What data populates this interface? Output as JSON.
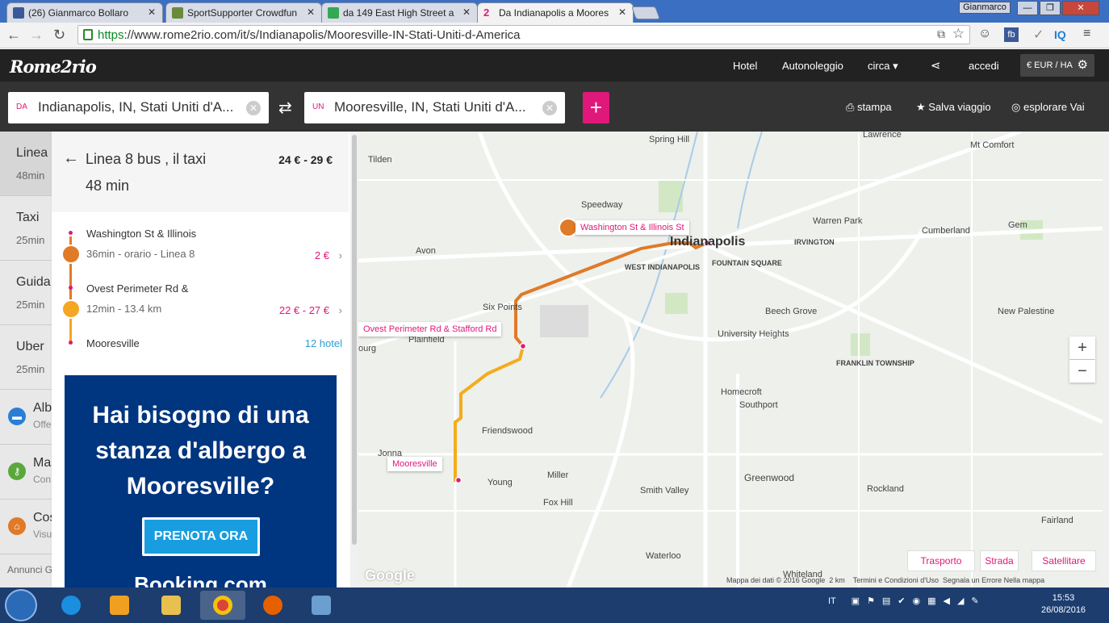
{
  "browser": {
    "tabs": [
      {
        "title": "(26) Gianmarco Bollaro",
        "icon": "facebook-icon",
        "color": "#3b5998"
      },
      {
        "title": "SportSupporter Crowdfun",
        "icon": "sportsupporter-icon",
        "color": "#6a8a3a"
      },
      {
        "title": "da 149 East High Street a",
        "icon": "google-maps-icon",
        "color": "#34a853"
      },
      {
        "title": "Da Indianapolis a Moores",
        "icon": "rome2rio-icon",
        "color": "#e0187a"
      }
    ],
    "user": "Gianmarco",
    "url_scheme": "https",
    "url_rest": "://www.rome2rio.com/it/s/Indianapolis/Mooresville-IN-Stati-Uniti-d-America"
  },
  "header": {
    "logo": "Rome2rio",
    "nav": [
      "Hotel",
      "Autonoleggio",
      "circa"
    ],
    "login": "accedi",
    "currency": "€ EUR / HA"
  },
  "search": {
    "from_label": "DA",
    "from_value": "Indianapolis, IN, Stati Uniti d'A...",
    "to_label": "UN",
    "to_value": "Mooresville, IN, Stati Uniti d'A...",
    "actions": {
      "print": "stampa",
      "save": "Salva viaggio",
      "explore": "esplorare Vai"
    }
  },
  "options": [
    {
      "name": "Linea",
      "time": "48min"
    },
    {
      "name": "Taxi",
      "time": "25min"
    },
    {
      "name": "Guida",
      "time": "25min"
    },
    {
      "name": "Uber",
      "time": "25min"
    }
  ],
  "services": [
    {
      "name": "Alb",
      "sub": "Offe",
      "icon": "bed-icon",
      "color": "#2a7fd4"
    },
    {
      "name": "Ma",
      "sub": "Con",
      "icon": "key-icon",
      "color": "#5aa83c"
    },
    {
      "name": "Cos",
      "sub": "Visu",
      "icon": "landmark-icon",
      "color": "#e07a28"
    }
  ],
  "ads_label": "Annunci G",
  "route": {
    "title": "Linea 8 bus , il taxi",
    "price": "24 € - 29 €",
    "duration": "48 min",
    "segments": [
      {
        "stop": "Washington St & Illinois",
        "detail": "36min - orario - Linea 8",
        "price": "2 €",
        "mode": "bus",
        "color": "#e07a28"
      },
      {
        "stop": "Ovest Perimeter Rd &",
        "detail": "12min - 13.4 km",
        "price": "22 € - 27 €",
        "mode": "taxi",
        "color": "#f5a623"
      }
    ],
    "destination": "Mooresville",
    "hotels": "12 hotel"
  },
  "banner": {
    "text": "Hai bisogno di una stanza d'albergo a Mooresville?",
    "button": "PRENOTA ORA",
    "logo": "Booking.com"
  },
  "map": {
    "towns": [
      "Lawrence",
      "Mt Comfort",
      "Spring Hill",
      "Tilden",
      "Speedway",
      "Indianapolis",
      "Warren Park",
      "Gem",
      "Cumberland",
      "Avon",
      "IRVINGTON",
      "WEST INDIANAPOLIS",
      "FOUNTAIN SQUARE",
      "Six Points",
      "Beech Grove",
      "New Palestine",
      "Plainfield",
      "ourg",
      "University Heights",
      "FRANKLIN TOWNSHIP",
      "Homecroft",
      "Southport",
      "Friendswood",
      "Jonna",
      "Young",
      "Miller",
      "Fox Hill",
      "Smith Valley",
      "Greenwood",
      "Rockland",
      "Fairland",
      "Waterloo",
      "Whiteland"
    ],
    "labels": [
      "Washington St & Illinois St",
      "Ovest Perimeter Rd & Stafford Rd",
      "Mooresville"
    ],
    "types": [
      "Trasporto",
      "Strada",
      "Satellitare"
    ],
    "attribution": "Mappa dei dati © 2016 Google",
    "scale": "2 km",
    "terms": "Termini e Condizioni d'Uso",
    "report": "Segnala un Errore Nella mappa",
    "google": "Google",
    "zoom_in": "+",
    "zoom_out": "−",
    "bus_color": "#e07a28",
    "taxi_color": "#f5ac1a"
  },
  "taskbar": {
    "lang": "IT",
    "time": "15:53",
    "date": "26/08/2016"
  }
}
